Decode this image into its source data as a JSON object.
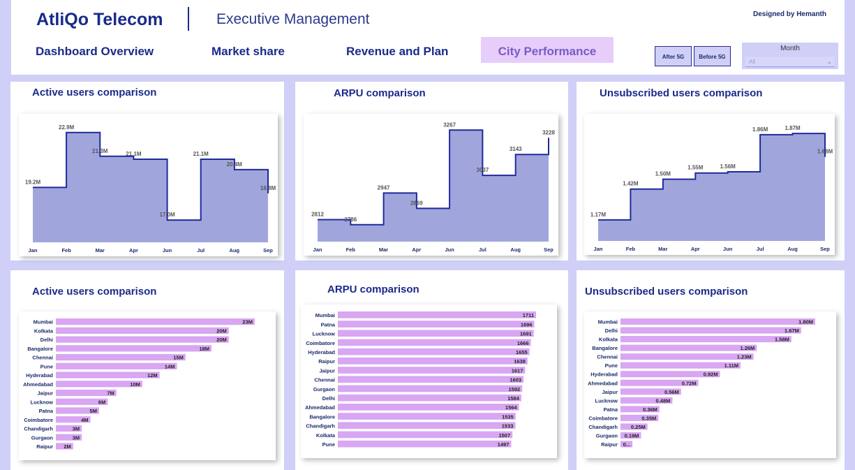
{
  "header": {
    "brand": "AtliQo Telecom",
    "subtitle": "Executive Management",
    "designer": "Designed by Hemanth",
    "nav": [
      "Dashboard Overview",
      "Market share",
      "Revenue and Plan",
      "City Performance"
    ],
    "toggles": [
      "After 5G",
      "Before 5G"
    ],
    "slicer": {
      "label": "Month",
      "value": "All"
    }
  },
  "colors": {
    "area_fill": "#a0a6dc",
    "area_line": "#1f2a9c",
    "bar_fill": "#d8a6f2",
    "title": "#1a2a8a",
    "background": "#cfcff8",
    "nav_active_bg": "#e7cdfa",
    "nav_active_text": "#7a5bc4"
  },
  "panels": {
    "p1": "Active users comparison",
    "p2": "ARPU comparison",
    "p3": "Unsubscribed users comparison",
    "p4": "Active users comparison",
    "p5": "ARPU comparison",
    "p6": "Unsubscribed users comparison"
  },
  "chart_data": [
    {
      "type": "area",
      "title": "Active users comparison",
      "categories": [
        "Jan",
        "Feb",
        "Mar",
        "Apr",
        "Jun",
        "Jul",
        "Aug",
        "Sep"
      ],
      "values": [
        19.2,
        22.9,
        21.3,
        21.1,
        17.0,
        21.1,
        20.4,
        18.8
      ],
      "labels": [
        "19.2M",
        "22.9M",
        "21.3M",
        "21.1M",
        "17.0M",
        "21.1M",
        "20.4M",
        "18.8M"
      ],
      "ylim": [
        15.5,
        23.5
      ]
    },
    {
      "type": "area",
      "title": "ARPU comparison",
      "categories": [
        "Jan",
        "Feb",
        "Mar",
        "Apr",
        "Jun",
        "Jul",
        "Aug",
        "Sep"
      ],
      "values": [
        2812,
        2786,
        2947,
        2869,
        3267,
        3037,
        3143,
        3228
      ],
      "labels": [
        "2812",
        "2786",
        "2947",
        "2869",
        "3267",
        "3037",
        "3143",
        "3228"
      ],
      "ylim": [
        2700,
        3300
      ]
    },
    {
      "type": "area",
      "title": "Unsubscribed users comparison",
      "categories": [
        "Jan",
        "Feb",
        "Mar",
        "Apr",
        "Jun",
        "Jul",
        "Aug",
        "Sep"
      ],
      "values": [
        1.17,
        1.42,
        1.5,
        1.55,
        1.56,
        1.86,
        1.87,
        1.68
      ],
      "labels": [
        "1.17M",
        "1.42M",
        "1.50M",
        "1.55M",
        "1.56M",
        "1.86M",
        "1.87M",
        "1.68M"
      ],
      "ylim": [
        1.0,
        1.95
      ]
    },
    {
      "type": "bar",
      "title": "Active users comparison",
      "categories": [
        "Mumbai",
        "Kolkata",
        "Delhi",
        "Bangalore",
        "Chennai",
        "Pune",
        "Hyderabad",
        "Ahmedabad",
        "Jaipur",
        "Lucknow",
        "Patna",
        "Coimbatore",
        "Chandigarh",
        "Gurgaon",
        "Raipur"
      ],
      "values": [
        23,
        20,
        20,
        18,
        15,
        14,
        12,
        10,
        7,
        6,
        5,
        4,
        3,
        3,
        2
      ],
      "labels": [
        "23M",
        "20M",
        "20M",
        "18M",
        "15M",
        "14M",
        "12M",
        "10M",
        "7M",
        "6M",
        "5M",
        "4M",
        "3M",
        "3M",
        "2M"
      ],
      "xlim": [
        0,
        23
      ]
    },
    {
      "type": "bar",
      "title": "ARPU comparison",
      "categories": [
        "Mumbai",
        "Patna",
        "Lucknow",
        "Coimbatore",
        "Hyderabad",
        "Raipur",
        "Jaipur",
        "Chennai",
        "Gurgaon",
        "Delhi",
        "Ahmedabad",
        "Bangalore",
        "Chandigarh",
        "Kolkata",
        "Pune"
      ],
      "values": [
        1711,
        1696,
        1691,
        1666,
        1655,
        1638,
        1617,
        1603,
        1592,
        1584,
        1564,
        1535,
        1533,
        1507,
        1497
      ],
      "labels": [
        "1711",
        "1696",
        "1691",
        "1666",
        "1655",
        "1638",
        "1617",
        "1603",
        "1592",
        "1584",
        "1564",
        "1535",
        "1533",
        "1507",
        "1497"
      ],
      "xlim": [
        0,
        1711
      ]
    },
    {
      "type": "bar",
      "title": "Unsubscribed users comparison",
      "categories": [
        "Mumbai",
        "Delhi",
        "Kolkata",
        "Bangalore",
        "Chennai",
        "Pune",
        "Hyderabad",
        "Ahmedabad",
        "Jaipur",
        "Lucknow",
        "Patna",
        "Coimbatore",
        "Chandigarh",
        "Gurgaon",
        "Raipur"
      ],
      "values": [
        1.8,
        1.67,
        1.58,
        1.26,
        1.23,
        1.11,
        0.92,
        0.72,
        0.56,
        0.48,
        0.36,
        0.35,
        0.25,
        0.19,
        0.11
      ],
      "labels": [
        "1.80M",
        "1.67M",
        "1.58M",
        "1.26M",
        "1.23M",
        "1.11M",
        "0.92M",
        "0.72M",
        "0.56M",
        "0.48M",
        "0.36M",
        "0.35M",
        "0.25M",
        "0.19M",
        "0..."
      ],
      "xlim": [
        0,
        1.8
      ]
    }
  ]
}
